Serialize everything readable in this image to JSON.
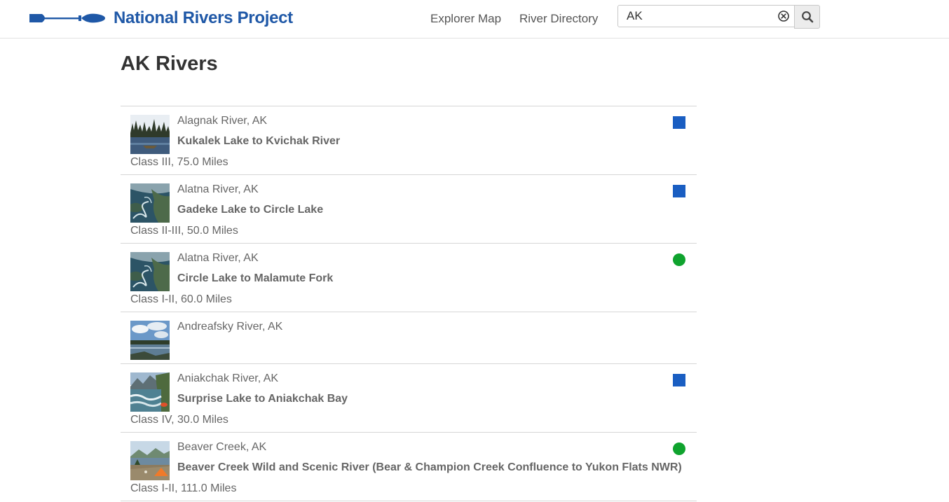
{
  "header": {
    "logo_text": "National Rivers Project",
    "nav": [
      {
        "label": "Explorer Map"
      },
      {
        "label": "River Directory"
      }
    ],
    "search": {
      "value": "AK",
      "placeholder": ""
    }
  },
  "colors": {
    "brand": "#1f58a7",
    "marker_square": "#1a5ec2",
    "marker_circle": "#0fa32e"
  },
  "page": {
    "title": "AK Rivers"
  },
  "rivers": [
    {
      "name": "Alagnak River, AK",
      "section": "Kukalek Lake to Kvichak River",
      "meta": "Class III, 75.0 Miles",
      "marker": "square",
      "thumb": "forest-lake"
    },
    {
      "name": "Alatna River, AK",
      "section": "Gadeke Lake to Circle Lake",
      "meta": "Class II-III, 50.0 Miles",
      "marker": "square",
      "thumb": "aerial-valley"
    },
    {
      "name": "Alatna River, AK",
      "section": "Circle Lake to Malamute Fork",
      "meta": "Class I-II, 60.0 Miles",
      "marker": "circle",
      "thumb": "aerial-valley"
    },
    {
      "name": "Andreafsky River, AK",
      "section": "",
      "meta": "",
      "marker": "none",
      "thumb": "sky-river"
    },
    {
      "name": "Aniakchak River, AK",
      "section": "Surprise Lake to Aniakchak Bay",
      "meta": "Class IV, 30.0 Miles",
      "marker": "square",
      "thumb": "whitewater"
    },
    {
      "name": "Beaver Creek, AK",
      "section": "Beaver Creek Wild and Scenic River (Bear & Champion Creek Confluence to Yukon Flats NWR)",
      "meta": "Class I-II, 111.0 Miles",
      "marker": "circle",
      "thumb": "camp-shore"
    }
  ]
}
